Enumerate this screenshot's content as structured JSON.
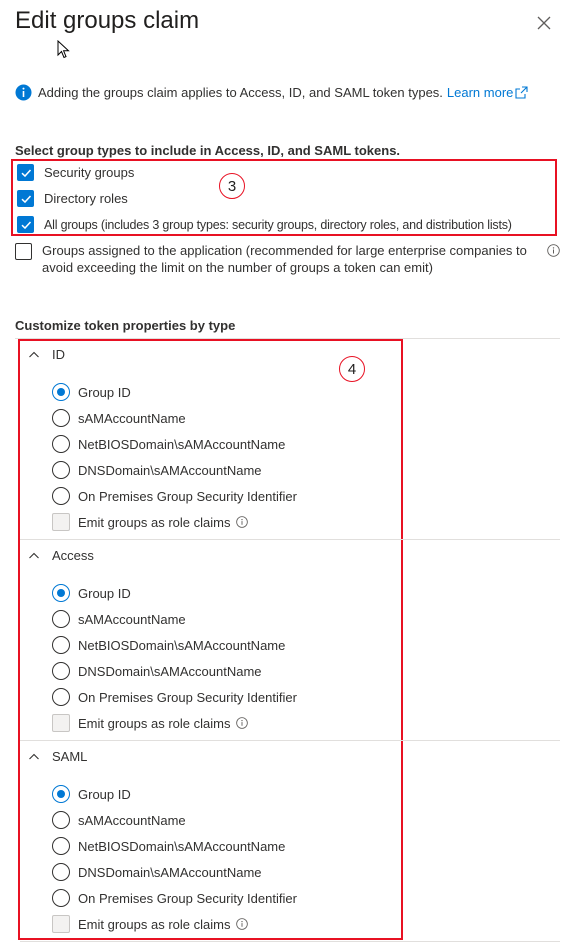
{
  "panel": {
    "title": "Edit groups claim",
    "close_icon": "close-icon"
  },
  "info": {
    "text": "Adding the groups claim applies to Access, ID, and SAML token types.",
    "link": "Learn more",
    "accent": "#0078d4"
  },
  "group_types": {
    "label": "Select group types to include in Access, ID, and SAML tokens.",
    "step": "3",
    "items": [
      {
        "label": "Security groups",
        "checked": true
      },
      {
        "label": "Directory roles",
        "checked": true
      },
      {
        "label": "All groups (includes 3 group types: security groups, directory roles, and distribution lists)",
        "checked": true
      }
    ],
    "app_groups": {
      "label": "Groups assigned to the application (recommended for large enterprise companies to avoid exceeding the limit on the number of groups a token can emit)",
      "checked": false
    }
  },
  "token_props": {
    "label": "Customize token properties by type",
    "step": "4",
    "options": [
      "Group ID",
      "sAMAccountName",
      "NetBIOSDomain\\sAMAccountName",
      "DNSDomain\\sAMAccountName",
      "On Premises Group Security Identifier"
    ],
    "emit_label": "Emit groups as role claims",
    "groups": [
      {
        "name": "ID",
        "selected": "Group ID",
        "emit_checked": false
      },
      {
        "name": "Access",
        "selected": "Group ID",
        "emit_checked": false
      },
      {
        "name": "SAML",
        "selected": "Group ID",
        "emit_checked": false
      }
    ]
  },
  "colors": {
    "annotation_red": "#e81123",
    "checkbox_blue": "#0078d4",
    "text": "#323130"
  }
}
